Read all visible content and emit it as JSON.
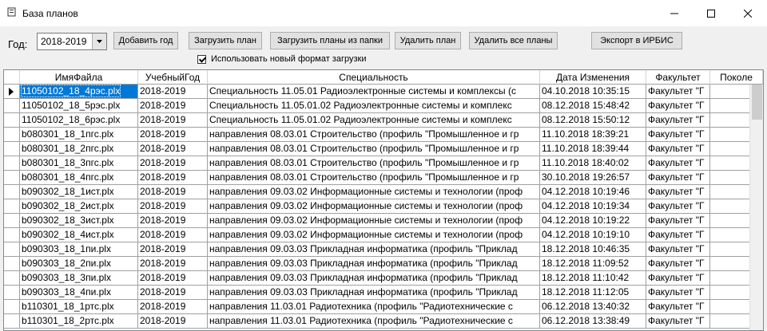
{
  "window": {
    "title": "База планов",
    "minimize_icon": "minimize-icon",
    "maximize_icon": "maximize-icon",
    "close_icon": "close-icon"
  },
  "toolbar": {
    "year_label": "Год:",
    "year_value": "2018-2019",
    "add_year": "Добавить год",
    "load_plan": "Загрузить план",
    "load_from_folder": "Загрузить планы из папки",
    "delete_plan": "Удалить план",
    "delete_all": "Удалить все планы",
    "export_irbis": "Экспорт в ИРБИС",
    "new_format_checkbox": "Использовать новый формат загрузки",
    "new_format_checked": true
  },
  "grid": {
    "columns": [
      "ИмяФайла",
      "УчебныйГод",
      "Специальность",
      "Дата Изменения",
      "Факультет",
      "Поколе"
    ],
    "rows": [
      [
        "11050102_18_4рэс.plx",
        "2018-2019",
        "Специальность 11.05.01 Радиоэлектронные системы  и комплексы (с",
        "04.10.2018 10:35:15",
        "Факультет \"Г",
        ""
      ],
      [
        "11050102_18_5рэс.plx",
        "2018-2019",
        "Специальность 11.05.01.02 Радиоэлектронные системы  и комплекс",
        "08.12.2018 15:48:42",
        "Факультет \"Г",
        ""
      ],
      [
        "11050102_18_6рэс.plx",
        "2018-2019",
        "Специальность 11.05.01.02 Радиоэлектронные системы  и комплекс",
        "08.12.2018 15:50:12",
        "Факультет \"Г",
        ""
      ],
      [
        "b080301_18_1пгс.plx",
        "2018-2019",
        "направления 08.03.01 Строительство (профиль \"Промышленное и гр",
        "11.10.2018 18:39:21",
        "Факультет \"Г",
        ""
      ],
      [
        "b080301_18_2пгс.plx",
        "2018-2019",
        "направления 08.03.01 Строительство (профиль \"Промышленное и гр",
        "11.10.2018 18:39:44",
        "Факультет \"Г",
        ""
      ],
      [
        "b080301_18_3пгс.plx",
        "2018-2019",
        "направления 08.03.01 Строительство (профиль \"Промышленное и гр",
        "11.10.2018 18:40:02",
        "Факультет \"Г",
        ""
      ],
      [
        "b080301_18_4пгс.plx",
        "2018-2019",
        "направления 08.03.01 Строительство (профиль \"Промышленное и гр",
        "30.10.2018 19:26:57",
        "Факультет \"Г",
        ""
      ],
      [
        "b090302_18_1ист.plx",
        "2018-2019",
        "направления 09.03.02 Информационные системы и технологии (проф",
        "04.12.2018 10:19:46",
        "Факультет \"Г",
        ""
      ],
      [
        "b090302_18_2ист.plx",
        "2018-2019",
        "направления 09.03.02 Информационные системы и технологии (проф",
        "04.12.2018 10:19:34",
        "Факультет \"Г",
        ""
      ],
      [
        "b090302_18_3ист.plx",
        "2018-2019",
        "направления 09.03.02 Информационные системы и технологии (проф",
        "04.12.2018 10:19:22",
        "Факультет \"Г",
        ""
      ],
      [
        "b090302_18_4ист.plx",
        "2018-2019",
        "направления 09.03.02 Информационные системы и технологии (проф",
        "04.12.2018 10:19:10",
        "Факультет \"Г",
        ""
      ],
      [
        "b090303_18_1пи.plx",
        "2018-2019",
        "направления 09.03.03 Прикладная информатика (профиль \"Приклад",
        "18.12.2018 10:46:35",
        "Факультет \"Г",
        ""
      ],
      [
        "b090303_18_2пи.plx",
        "2018-2019",
        "направления 09.03.03 Прикладная информатика (профиль \"Приклад",
        "18.12.2018 11:09:52",
        "Факультет \"Г",
        ""
      ],
      [
        "b090303_18_3пи.plx",
        "2018-2019",
        "направления 09.03.03 Прикладная информатика (профиль \"Приклад",
        "18.12.2018 11:10:42",
        "Факультет \"Г",
        ""
      ],
      [
        "b090303_18_4пи.plx",
        "2018-2019",
        "направления 09.03.03 Прикладная информатика (профиль \"Приклад",
        "18.12.2018 11:12:05",
        "Факультет \"Г",
        ""
      ],
      [
        "b110301_18_1ртс.plx",
        "2018-2019",
        "направления 11.03.01 Радиотехника (профиль \"Радиотехнические с",
        "06.12.2018 13:40:32",
        "Факультет \"Г",
        ""
      ],
      [
        "b110301_18_2ртс.plx",
        "2018-2019",
        "направления 11.03.01 Радиотехника (профиль \"Радиотехнические с",
        "06.12.2018 13:38:49",
        "Факультет \"Г",
        ""
      ]
    ]
  }
}
